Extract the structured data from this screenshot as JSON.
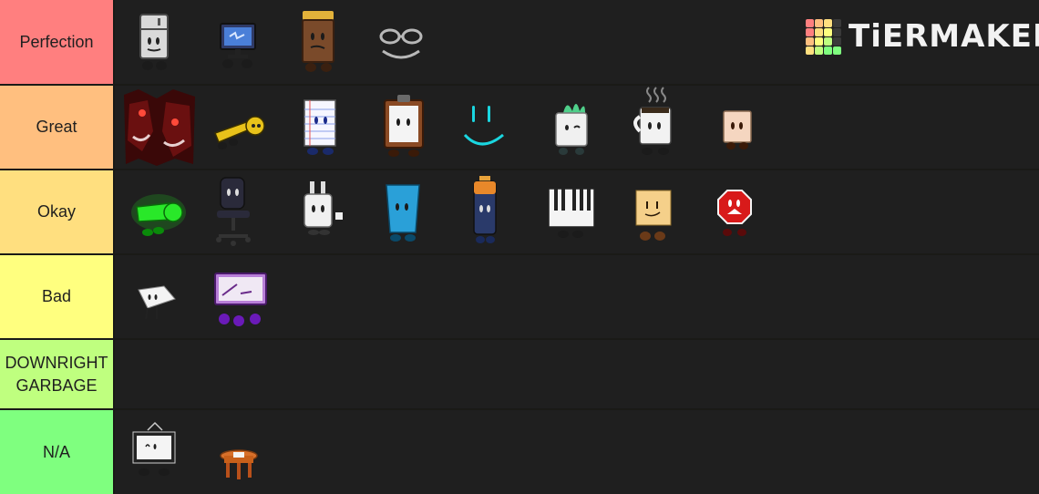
{
  "app": {
    "logo_text": "TiERMAKER"
  },
  "colors": {
    "background": "#1a1a17",
    "row_area": "#1f1f1f",
    "logo_cells": [
      "#ff7f7f",
      "#ffbf7f",
      "#ffdf7f",
      "#3a3a3a",
      "#ff7f7f",
      "#ffdf7f",
      "#ffff7f",
      "#3a3a3a",
      "#ffbf7f",
      "#ffff7f",
      "#bfff7f",
      "#3a3a3a",
      "#ffdf7f",
      "#bfff7f",
      "#7fff7f",
      "#7fff7f"
    ]
  },
  "tiers": [
    {
      "label": "Perfection",
      "color": "#ff7f7f",
      "items": [
        "fridge-character-icon",
        "computer-monitor-character-icon",
        "chocolate-bar-character-icon",
        "glasses-character-icon"
      ]
    },
    {
      "label": "Great",
      "color": "#ffbf7f",
      "items": [
        "shadow-monster-character-icon",
        "yellow-key-character-icon",
        "notepad-character-icon",
        "clipboard-character-icon",
        "cyan-smile-face-icon",
        "plant-pot-character-icon",
        "coffee-mug-character-icon",
        "paper-bag-character-icon"
      ]
    },
    {
      "label": "Okay",
      "color": "#ffdf7f",
      "items": [
        "green-key-character-icon",
        "office-chair-character-icon",
        "plug-character-icon",
        "cup-character-icon",
        "battery-character-icon",
        "piano-character-icon",
        "sticky-note-character-icon",
        "stop-sign-character-icon"
      ]
    },
    {
      "label": "Bad",
      "color": "#ffff7f",
      "items": [
        "paper-character-icon",
        "tv-screen-character-icon"
      ]
    },
    {
      "label": "DOWNRIGHT\nGARBAGE",
      "color": "#bfff7f",
      "items": []
    },
    {
      "label": "N/A",
      "color": "#7fff7f",
      "items": [
        "picture-frame-character-icon",
        "stool-character-icon"
      ]
    }
  ]
}
